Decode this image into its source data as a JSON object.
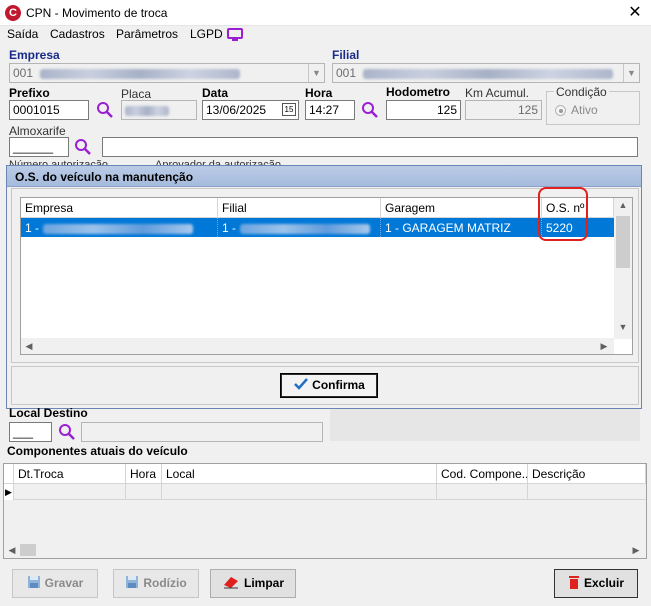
{
  "window": {
    "title": "CPN - Movimento de troca",
    "logo_letter": "C"
  },
  "menu": {
    "items": [
      "Saída",
      "Cadastros",
      "Parâmetros",
      "LGPD"
    ]
  },
  "form": {
    "empresa_label": "Empresa",
    "empresa_value": "001",
    "filial_label": "Filial",
    "filial_value": "001",
    "prefixo_label": "Prefixo",
    "prefixo_value": "0001015",
    "placa_label": "Placa",
    "data_label": "Data",
    "data_value": "13/06/2025",
    "calendar_badge": "15",
    "hora_label": "Hora",
    "hora_value": "14:27",
    "hodometro_label": "Hodometro",
    "hodometro_value": "125",
    "km_acumul_label": "Km Acumul.",
    "km_acumul_value": "125",
    "condicao_label": "Condição",
    "ativo_label": "Ativo",
    "almoxarife_label": "Almoxarife",
    "almoxarife_value": "______",
    "local_destino_label": "Local Destino",
    "local_destino_value": "___",
    "componentes_label": "Componentes atuais do veículo",
    "numero_autorizacao_label": "Número autorização",
    "aprovador_autorizacao_label": "Aprovador da autorização"
  },
  "dialog": {
    "title": "O.S. do veículo na manutenção",
    "columns": [
      "Empresa",
      "Filial",
      "Garagem",
      "O.S. nº"
    ],
    "rows": [
      {
        "empresa": "1 -",
        "filial": "1 -",
        "garagem": "1 - GARAGEM MATRIZ",
        "os": "5220"
      }
    ],
    "confirm_label": "Confirma"
  },
  "components_grid": {
    "columns": [
      "Dt.Troca",
      "Hora",
      "Local",
      "Cod. Compone...",
      "Descrição"
    ]
  },
  "buttons": {
    "gravar": "Gravar",
    "rodizio": "Rodízio",
    "limpar": "Limpar",
    "excluir": "Excluir"
  },
  "colors": {
    "accent": "#0078d7",
    "label_blue": "#1a2a88",
    "highlight_red": "#e0201d",
    "lgpd_purple": "#9b1fd1"
  }
}
